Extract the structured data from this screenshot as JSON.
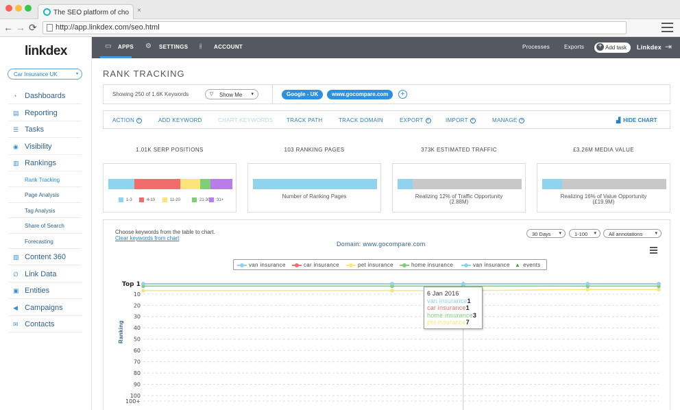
{
  "browser": {
    "tab_title": "The SEO platform of cho",
    "tab_close": "×",
    "url": "http://app.linkdex.com/seo.html",
    "back": "←",
    "forward": "→",
    "reload": "⟳"
  },
  "sidebar": {
    "logo": "linkdex",
    "project": "Car Insurance UK",
    "items": [
      {
        "label": "Dashboards",
        "icon": "dashboard-icon",
        "glyph": "◔"
      },
      {
        "label": "Reporting",
        "icon": "document-icon",
        "glyph": "▤"
      },
      {
        "label": "Tasks",
        "icon": "list-icon",
        "glyph": "☰"
      },
      {
        "label": "Visibility",
        "icon": "eye-icon",
        "glyph": "◉"
      },
      {
        "label": "Rankings",
        "icon": "bar-chart-icon",
        "glyph": "▥"
      }
    ],
    "subitems": [
      "Rank Tracking",
      "Page Analysis",
      "Tag Analysis",
      "Share of Search",
      "Forecasting"
    ],
    "items2": [
      {
        "label": "Content 360",
        "icon": "book-icon",
        "glyph": "▧"
      },
      {
        "label": "Link Data",
        "icon": "link-icon",
        "glyph": "∅"
      },
      {
        "label": "Entities",
        "icon": "entity-icon",
        "glyph": "▣"
      },
      {
        "label": "Campaigns",
        "icon": "megaphone-icon",
        "glyph": "◀"
      },
      {
        "label": "Contacts",
        "icon": "envelope-icon",
        "glyph": "✉"
      }
    ]
  },
  "topnav": {
    "apps": "APPS",
    "settings": "SETTINGS",
    "account": "ACCOUNT",
    "processes": "Processes",
    "exports": "Exports",
    "add_task": "Add task",
    "user": "Linkdex",
    "apps_glyph": "▭",
    "settings_glyph": "⚙",
    "account_glyph": "⫲",
    "logout_glyph": "⇥",
    "plus_glyph": "+"
  },
  "page": {
    "title": "RANK TRACKING",
    "showing": "Showing 250 of 1.6K Keywords",
    "show_me": "Show Me",
    "filter_glyph": "▽",
    "caret": "▾",
    "chips": [
      "Google - UK",
      "www.gocompare.com"
    ],
    "chip_add": "+"
  },
  "actions": {
    "items": [
      "ACTION",
      "ADD KEYWORD",
      "CHART KEYWORDS",
      "TRACK PATH",
      "TRACK DOMAIN",
      "EXPORT",
      "IMPORT",
      "MANAGE"
    ],
    "plus_glyph": "+",
    "hide_chart": "HIDE CHART",
    "hide_chart_glyph": "▟"
  },
  "metrics": [
    {
      "title": "1.01K SERP POSITIONS"
    },
    {
      "title": "103 RANKING PAGES",
      "label": "Number of Ranking Pages"
    },
    {
      "title": "373K ESTIMATED TRAFFIC",
      "label": "Realizing 12% of Traffic Opportunity",
      "sub": "(2.88M)",
      "progress": 12
    },
    {
      "title": "£3.26M MEDIA VALUE",
      "label": "Realizing 16% of Value Opportunity",
      "sub": "(£19.9M)",
      "progress": 16
    }
  ],
  "serp_legend": [
    {
      "label": "1-3",
      "color": "#8fd3ee"
    },
    {
      "label": "4-10",
      "color": "#f26c6c"
    },
    {
      "label": "11-20",
      "color": "#fbe57a"
    },
    {
      "label": "21-30",
      "color": "#7fcf78"
    },
    {
      "label": "31+",
      "color": "#b97ce8"
    }
  ],
  "chart_panel": {
    "choose": "Choose keywords from the table to chart.",
    "clear": "Clear keywords from chart",
    "domain": "Domain: www.gocompare.com",
    "dropdowns": [
      "30 Days",
      "1-100",
      "All annotations"
    ],
    "caret": "▾",
    "legend": [
      {
        "label": "van insurance",
        "color": "#8fd3ee"
      },
      {
        "label": "car insurance",
        "color": "#f26c6c"
      },
      {
        "label": "pet insurance",
        "color": "#fbe57a"
      },
      {
        "label": "home insurance",
        "color": "#7fcf78"
      },
      {
        "label": "van insurance",
        "color": "#8fd3ee"
      },
      {
        "label": "events",
        "color": "#4a9a3a"
      }
    ],
    "events_glyph": "▲",
    "y_title": "Ranking",
    "tooltip": {
      "date": "6 Jan 2016",
      "rows": [
        {
          "name": "van insurance",
          "value": "1"
        },
        {
          "name": "car insurance",
          "value": "1"
        },
        {
          "name": "home insurance",
          "value": "3"
        },
        {
          "name": "pet insurance",
          "value": "7"
        }
      ]
    }
  },
  "chart_data": {
    "type": "line",
    "ylabel": "Ranking",
    "yticks": [
      "Top 1",
      "10",
      "20",
      "30",
      "40",
      "50",
      "60",
      "70",
      "80",
      "90",
      "100",
      "100+"
    ],
    "ylim": [
      1,
      100
    ],
    "y_reversed": true,
    "series": [
      {
        "name": "van insurance",
        "color": "#8fd3ee",
        "values": [
          1,
          1,
          1,
          1,
          1
        ]
      },
      {
        "name": "car insurance",
        "color": "#f26c6c",
        "values": [
          1,
          1,
          1,
          1,
          1
        ]
      },
      {
        "name": "pet insurance",
        "color": "#fbe57a",
        "values": [
          7,
          7,
          7,
          6,
          6
        ]
      },
      {
        "name": "home insurance",
        "color": "#7fcf78",
        "values": [
          3,
          3,
          3,
          3,
          3
        ]
      },
      {
        "name": "van insurance",
        "color": "#8fd3ee",
        "values": [
          1,
          1,
          1,
          1,
          1
        ]
      }
    ],
    "marker_points": [
      0,
      14,
      18,
      25,
      29
    ],
    "x_extent": 29,
    "crosshair_index": 18,
    "grid": "horizontal-dashed"
  }
}
